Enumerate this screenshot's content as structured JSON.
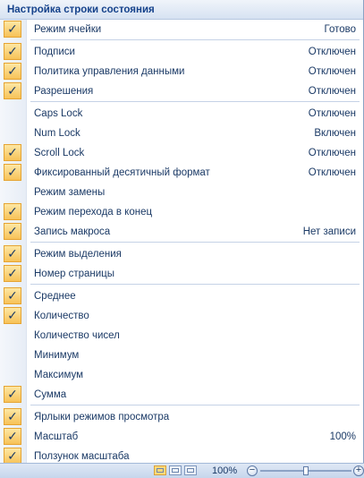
{
  "menu": {
    "title": "Настройка строки состояния",
    "check_mark": "✓",
    "items": [
      {
        "label": "Режим ячейки",
        "value": "Готово",
        "checked": true
      },
      {
        "sep": true
      },
      {
        "label": "Подписи",
        "value": "Отключен",
        "checked": true
      },
      {
        "label": "Политика управления данными",
        "value": "Отключен",
        "checked": true
      },
      {
        "label": "Разрешения",
        "value": "Отключен",
        "checked": true
      },
      {
        "sep": true
      },
      {
        "label": "Caps Lock",
        "value": "Отключен",
        "checked": false
      },
      {
        "label": "Num Lock",
        "value": "Включен",
        "checked": false
      },
      {
        "label": "Scroll Lock",
        "value": "Отключен",
        "checked": true
      },
      {
        "label": "Фиксированный десятичный формат",
        "value": "Отключен",
        "checked": true
      },
      {
        "label": "Режим замены",
        "value": "",
        "checked": false
      },
      {
        "label": "Режим перехода  в конец",
        "value": "",
        "checked": true
      },
      {
        "label": "Запись макроса",
        "value": "Нет записи",
        "checked": true
      },
      {
        "sep": true
      },
      {
        "label": "Режим выделения",
        "value": "",
        "checked": true
      },
      {
        "label": "Номер страницы",
        "value": "",
        "checked": true
      },
      {
        "sep": true
      },
      {
        "label": "Среднее",
        "value": "",
        "checked": true
      },
      {
        "label": "Количество",
        "value": "",
        "checked": true
      },
      {
        "label": "Количество чисел",
        "value": "",
        "checked": false
      },
      {
        "label": "Минимум",
        "value": "",
        "checked": false
      },
      {
        "label": "Максимум",
        "value": "",
        "checked": false
      },
      {
        "label": "Сумма",
        "value": "",
        "checked": true
      },
      {
        "sep": true
      },
      {
        "label": "Ярлыки режимов просмотра",
        "value": "",
        "checked": true
      },
      {
        "label": "Масштаб",
        "value": "100%",
        "checked": true
      },
      {
        "label": "Ползунок масштаба",
        "value": "",
        "checked": true
      }
    ]
  },
  "statusbar": {
    "zoom_text": "100%",
    "zoom_out": "−",
    "zoom_in": "+",
    "zoom_level": 0.5
  }
}
